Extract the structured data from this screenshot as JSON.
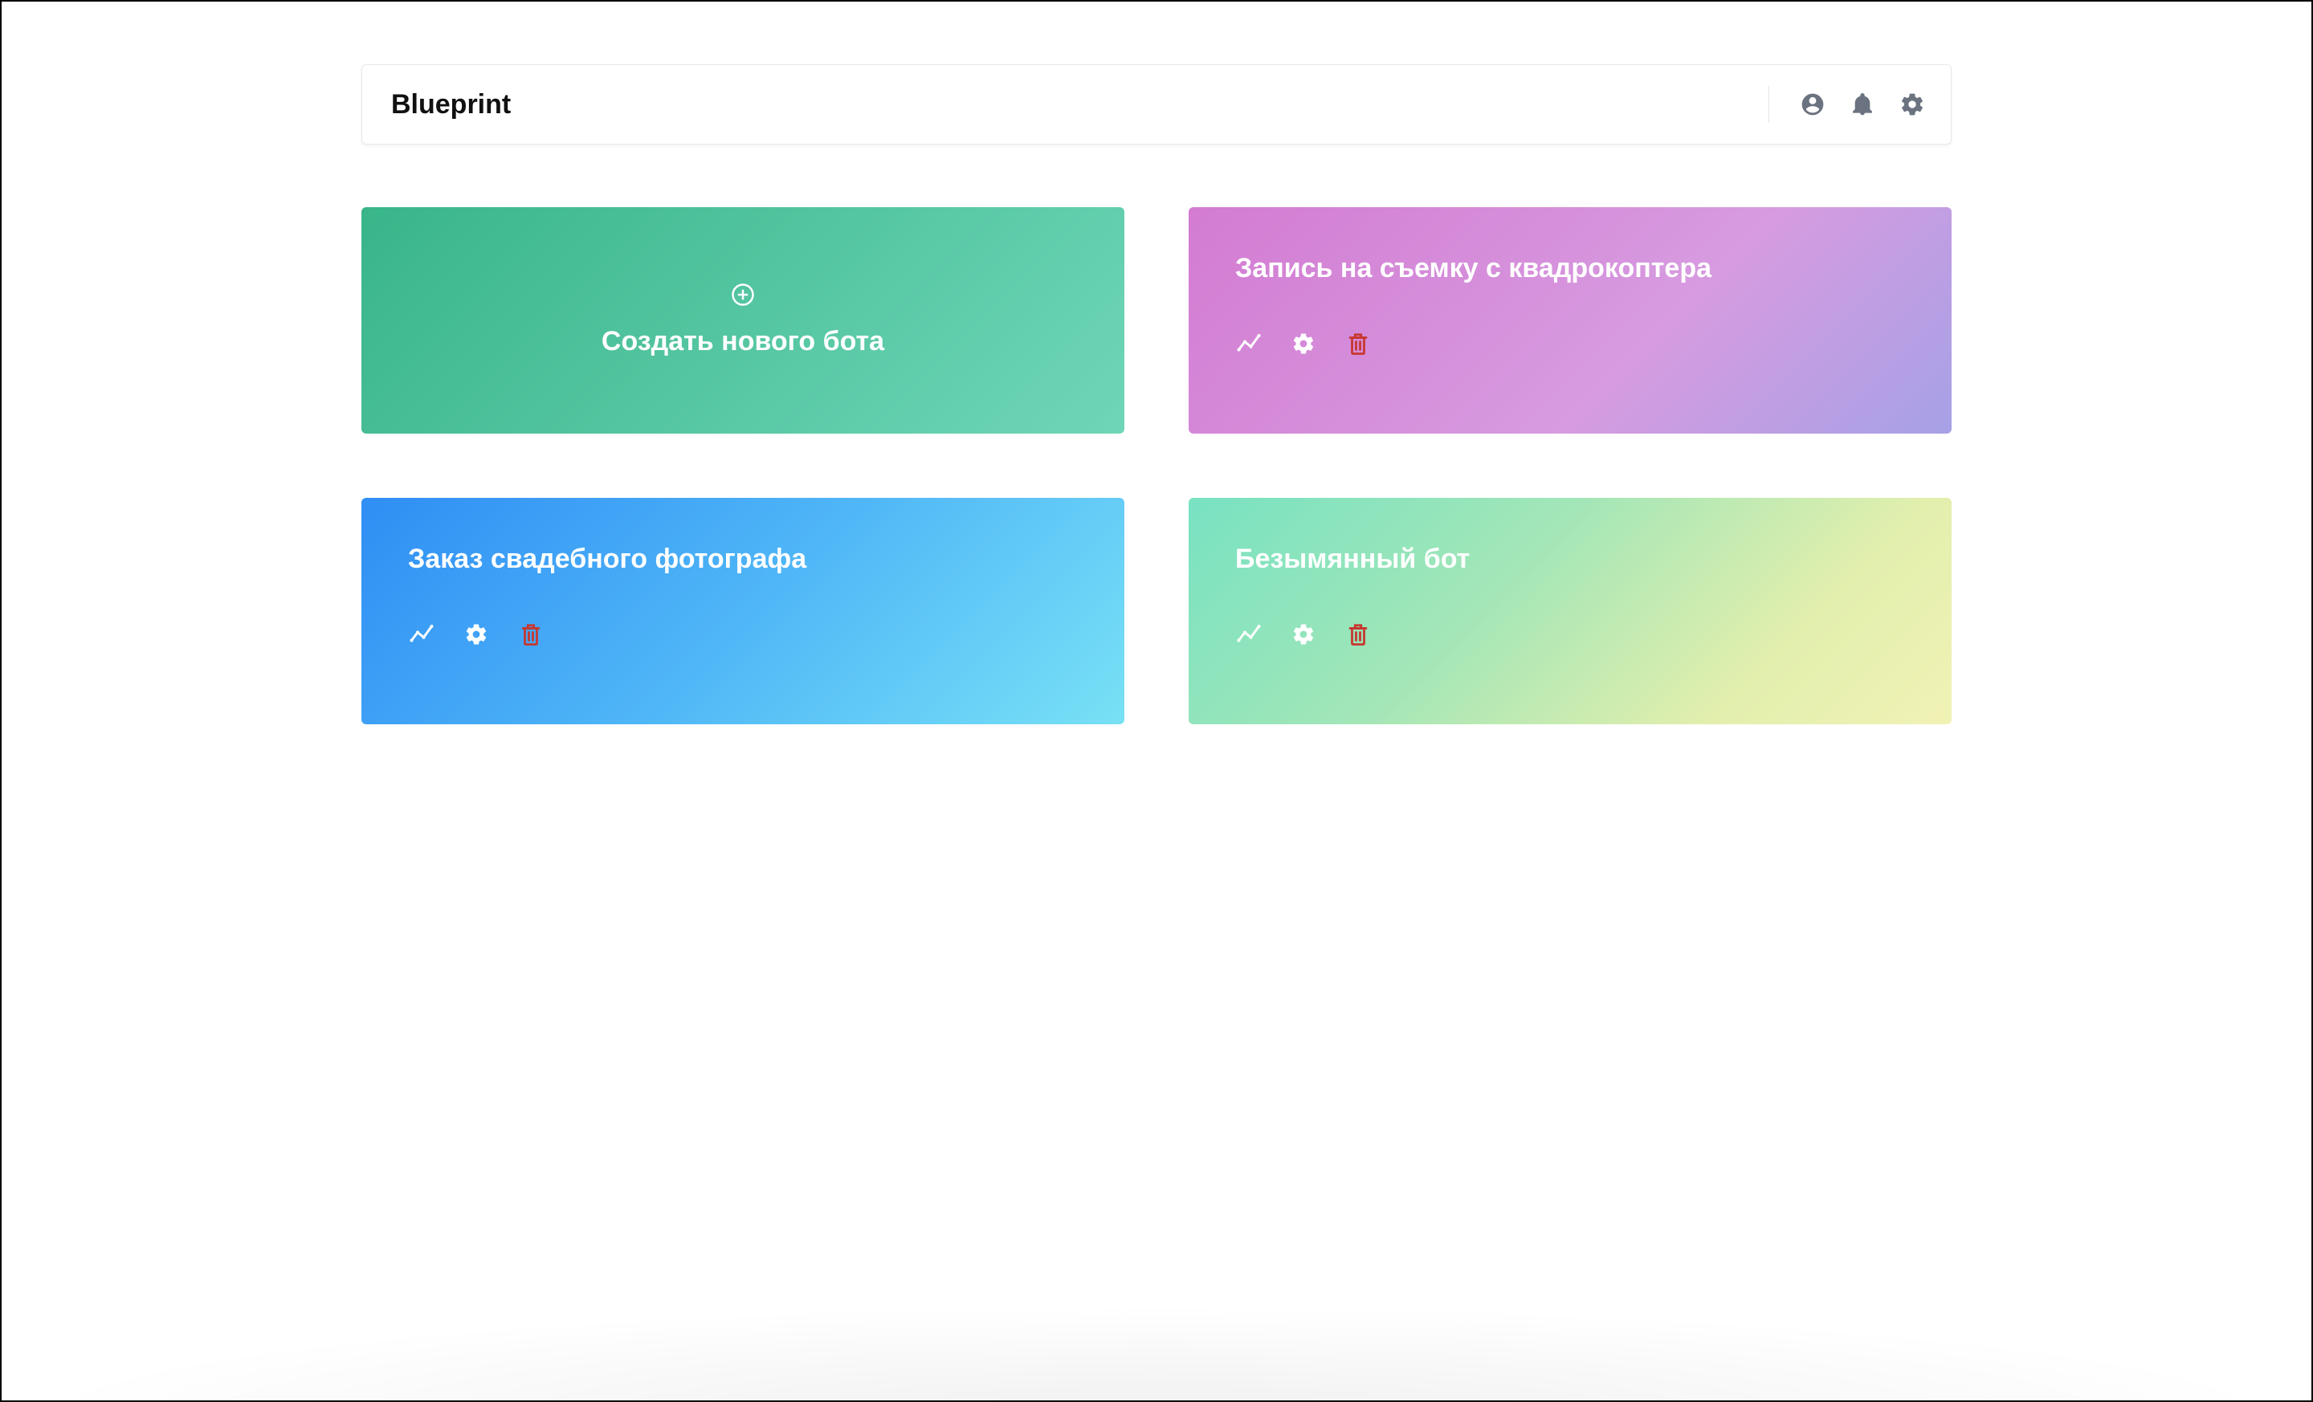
{
  "header": {
    "title": "Blueprint"
  },
  "create_card": {
    "label": "Создать нового бота"
  },
  "bots": [
    {
      "title": "Запись на съемку с квадрокоптера",
      "gradient": "g-pink"
    },
    {
      "title": "Заказ свадебного фотографа",
      "gradient": "g-blue"
    },
    {
      "title": "Безымянный бот",
      "gradient": "g-mint"
    }
  ],
  "colors": {
    "delete_icon": "#c7372f",
    "topbar_icon": "#6b7280"
  }
}
